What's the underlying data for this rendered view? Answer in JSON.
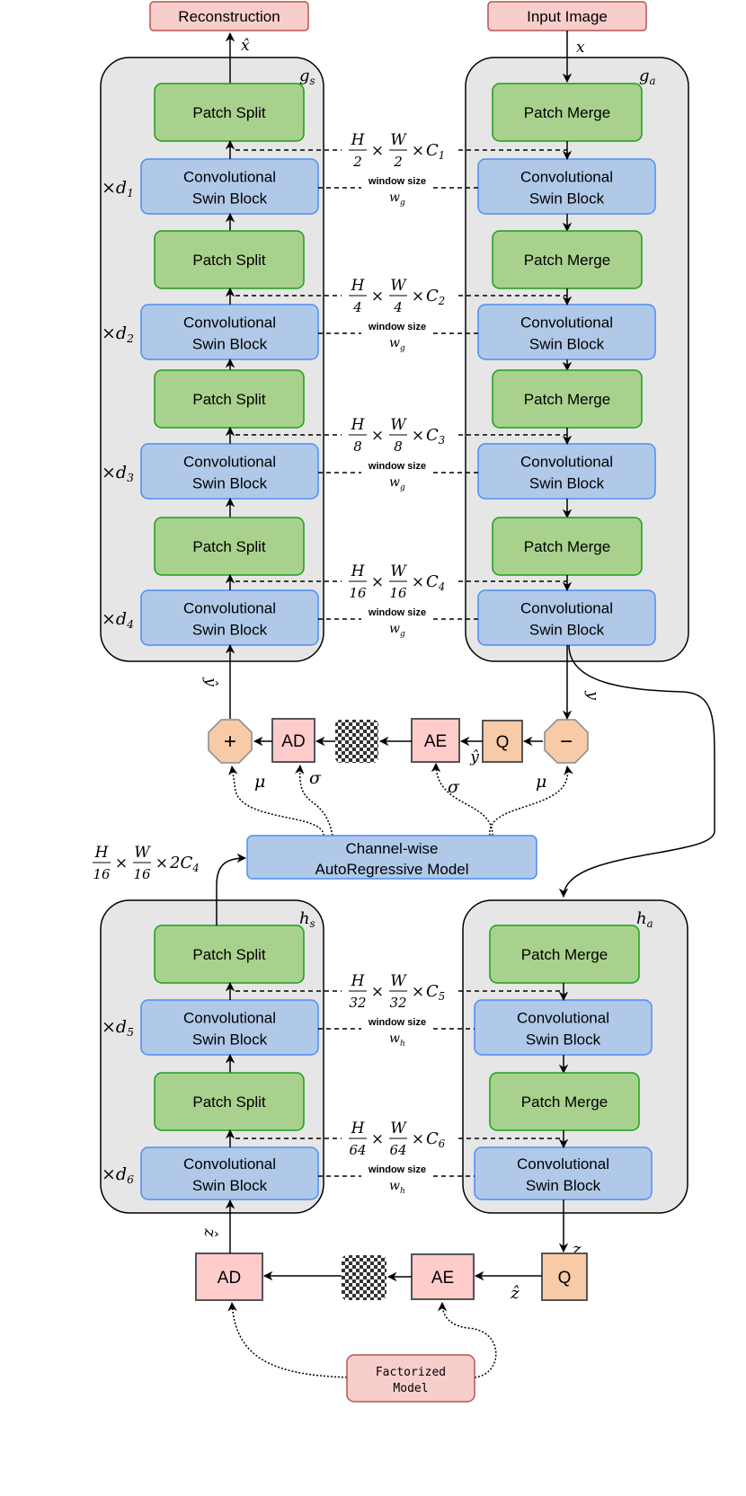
{
  "io": {
    "reconstruction": "Reconstruction",
    "input": "Input Image",
    "x_hat": "x̂",
    "x": "x"
  },
  "colors": {
    "green_fill": "#a9d18e",
    "green_stroke": "#1a9e1a",
    "blue_fill": "#b0c9e8",
    "blue_stroke": "#4d8ef5",
    "red_fill": "#f8cecc",
    "red_stroke": "#b85450",
    "container_fill": "#e6e6e6",
    "orange_fill": "#f7cba8",
    "pink_fill": "#ffcccc"
  },
  "blocks": {
    "patch_split": "Patch Split",
    "patch_merge": "Patch Merge",
    "conv_line1": "Convolutional",
    "conv_line2": "Swin Block"
  },
  "containers": {
    "gs": {
      "base": "g",
      "sub": "s"
    },
    "ga": {
      "base": "g",
      "sub": "a"
    },
    "hs": {
      "base": "h",
      "sub": "s"
    },
    "ha": {
      "base": "h",
      "sub": "a"
    }
  },
  "window_label": "window size",
  "main_stages": [
    {
      "repeat": "×d",
      "repeat_sub": "1",
      "h": "H",
      "h_den": "2",
      "w": "W",
      "w_den": "2",
      "c": "C",
      "c_sub": "1",
      "win": "w",
      "win_sub": "g"
    },
    {
      "repeat": "×d",
      "repeat_sub": "2",
      "h": "H",
      "h_den": "4",
      "w": "W",
      "w_den": "4",
      "c": "C",
      "c_sub": "2",
      "win": "w",
      "win_sub": "g"
    },
    {
      "repeat": "×d",
      "repeat_sub": "3",
      "h": "H",
      "h_den": "8",
      "w": "W",
      "w_den": "8",
      "c": "C",
      "c_sub": "3",
      "win": "w",
      "win_sub": "g"
    },
    {
      "repeat": "×d",
      "repeat_sub": "4",
      "h": "H",
      "h_den": "16",
      "w": "W",
      "w_den": "16",
      "c": "C",
      "c_sub": "4",
      "win": "w",
      "win_sub": "g"
    }
  ],
  "hyper_stages": [
    {
      "repeat": "×d",
      "repeat_sub": "5",
      "h": "H",
      "h_den": "32",
      "w": "W",
      "w_den": "32",
      "c": "C",
      "c_sub": "5",
      "win": "w",
      "win_sub": "h"
    },
    {
      "repeat": "×d",
      "repeat_sub": "6",
      "h": "H",
      "h_den": "64",
      "w": "W",
      "w_den": "64",
      "c": "C",
      "c_sub": "6",
      "win": "w",
      "win_sub": "h"
    }
  ],
  "middle": {
    "plus": "+",
    "minus": "−",
    "ad": "AD",
    "ae": "AE",
    "q": "Q",
    "y": "y",
    "y_hat": "ŷ",
    "y_hat_q": "ŷ",
    "mu": "μ",
    "sigma": "σ",
    "channel_line1": "Channel-wise",
    "channel_line2": "AutoRegressive Model",
    "dims": {
      "h": "H",
      "h_den": "16",
      "w": "W",
      "w_den": "16",
      "c": "2C",
      "c_sub": "4"
    }
  },
  "bottom": {
    "ad": "AD",
    "ae": "AE",
    "q": "Q",
    "z": "z",
    "z_hat": "ẑ",
    "z_hat_left": "ẑ",
    "factorized_line1": "Factorized",
    "factorized_line2": "Model"
  },
  "times": "×"
}
